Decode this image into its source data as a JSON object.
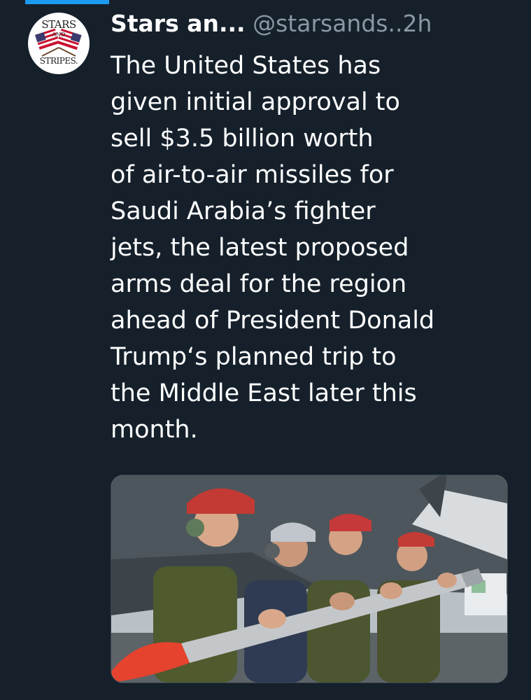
{
  "tweet": {
    "author": {
      "display_name": "Stars an...",
      "handle": "@starsands..",
      "avatar_logo": {
        "line1": "STARS",
        "line2": "AND",
        "line3": "STRIPES."
      }
    },
    "separator": " ",
    "time": "2h",
    "text_lines": [
      "The United States has",
      "given initial approval to",
      "sell $3.5 billion worth",
      "of air-to-air missiles for",
      "Saudi Arabia’s fighter",
      "jets, the latest proposed",
      "arms deal for the region",
      "ahead of President Donald",
      "Trump‘s planned trip to",
      "the Middle East later this",
      "month."
    ],
    "media": {
      "icon": "photo-of-crew-carrying-missile"
    }
  },
  "colors": {
    "background": "#15202b",
    "text": "#ffffff",
    "secondary_text": "#8b98a5",
    "accent": "#1d9bf0",
    "missile_nose": "#e5432e"
  }
}
